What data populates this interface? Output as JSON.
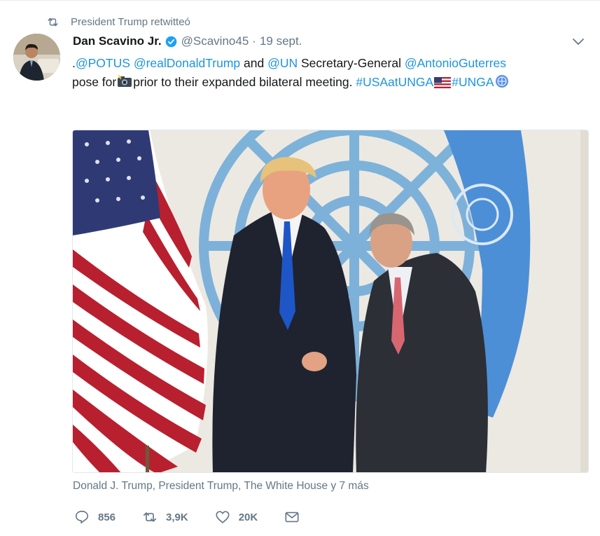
{
  "retweet": {
    "label": "President Trump retwitteó",
    "icon": "retweet-icon"
  },
  "tweet": {
    "author_name": "Dan Scavino Jr.",
    "verified_icon": "verified-badge-icon",
    "handle": "@Scavino45",
    "separator": "·",
    "date": "19 sept.",
    "text": {
      "prefix": ".",
      "mention_potus": "@POTUS",
      "mention_trump": "@realDonaldTrump",
      "and": " and ",
      "mention_un": "@UN",
      "secretary_general": " Secretary-General ",
      "mention_guterres": "@AntonioGuterres",
      "pose_for": "pose for",
      "rest": "prior to their expanded bilateral meeting. ",
      "hashtag_usa": "#USAatUNGA",
      "hashtag_unga": "#UNGA"
    },
    "tagged_people": "Donald J. Trump, President Trump, The White House y 7 más",
    "stats": {
      "replies": "856",
      "retweets": "3,9K",
      "likes": "20K"
    }
  },
  "colors": {
    "link": "#1b95e0",
    "muted": "#657786",
    "verified": "#1da1f2",
    "un_blue": "#5b92e5"
  }
}
